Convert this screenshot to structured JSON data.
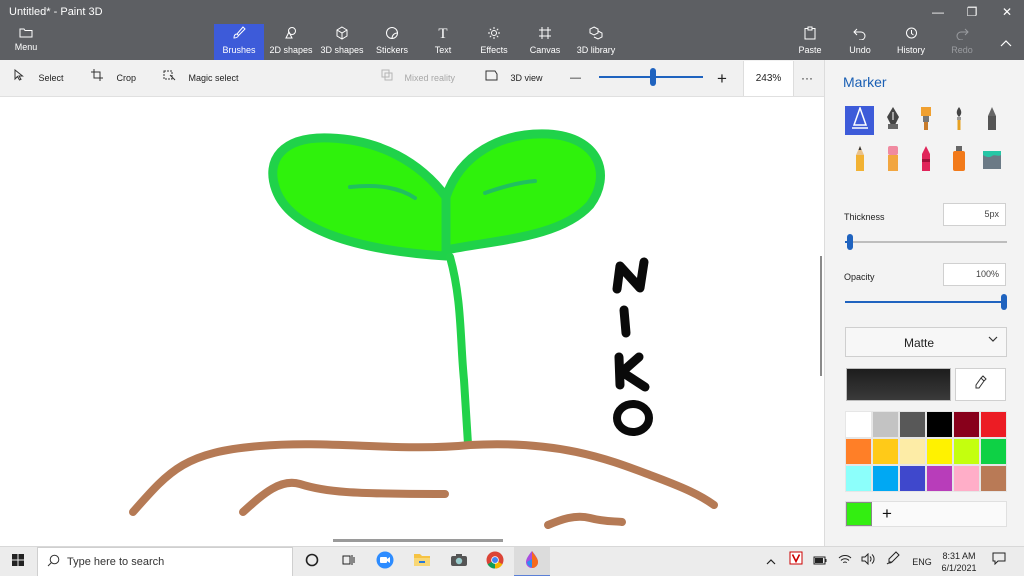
{
  "window": {
    "title": "Untitled* - Paint 3D",
    "minimize": "—",
    "maximize": "❐",
    "close": "✕"
  },
  "ribbon": {
    "menu_label": "Menu",
    "tools": [
      {
        "label": "Brushes",
        "icon": "brush-icon",
        "active": true
      },
      {
        "label": "2D shapes",
        "icon": "shapes-2d-icon"
      },
      {
        "label": "3D shapes",
        "icon": "cube-icon"
      },
      {
        "label": "Stickers",
        "icon": "sticker-icon"
      },
      {
        "label": "Text",
        "icon": "text-icon",
        "glyph": "T"
      },
      {
        "label": "Effects",
        "icon": "sun-icon"
      },
      {
        "label": "Canvas",
        "icon": "canvas-icon"
      },
      {
        "label": "3D library",
        "icon": "library-icon"
      }
    ],
    "right_tools": [
      {
        "label": "Paste",
        "icon": "paste-icon"
      },
      {
        "label": "Undo",
        "icon": "undo-icon"
      },
      {
        "label": "History",
        "icon": "history-icon"
      },
      {
        "label": "Redo",
        "icon": "redo-icon",
        "disabled": true
      }
    ]
  },
  "toolbar": {
    "select": "Select",
    "crop": "Crop",
    "magic_select": "Magic select",
    "mixed_reality": "Mixed reality",
    "view_3d": "3D view",
    "zoom_out": "—",
    "zoom_in": "+",
    "zoom_value": "243%",
    "zoom_fraction": 0.52,
    "more": "···"
  },
  "canvas": {
    "drawing_text": "NIKO",
    "colors": {
      "leaf_fill": "#2ff20c",
      "leaf_outline": "#20d24a",
      "stem": "#22d24a",
      "soil": "#b57a55",
      "ink": "#0a0a0a"
    }
  },
  "panel": {
    "title": "Marker",
    "brushes": [
      {
        "name": "marker-brush-icon",
        "selected": true
      },
      {
        "name": "calligraphy-pen-icon"
      },
      {
        "name": "oil-brush-icon"
      },
      {
        "name": "watercolor-icon"
      },
      {
        "name": "pixel-pen-icon"
      },
      {
        "name": "pencil-icon"
      },
      {
        "name": "eraser-icon"
      },
      {
        "name": "crayon-icon"
      },
      {
        "name": "spray-can-icon"
      },
      {
        "name": "fill-bucket-icon"
      }
    ],
    "thickness_label": "Thickness",
    "thickness_value": "5px",
    "thickness_fraction": 0.03,
    "opacity_label": "Opacity",
    "opacity_value": "100%",
    "opacity_fraction": 1.0,
    "finish": "Matte",
    "current_color": "#262626",
    "palette": [
      "#ffffff",
      "#c3c3c3",
      "#585858",
      "#000000",
      "#88001b",
      "#ec1c24",
      "#ff7f27",
      "#ffca18",
      "#fdeca6",
      "#fff200",
      "#c4ff0e",
      "#0ed145",
      "#8cfffb",
      "#00a8f3",
      "#3f48cc",
      "#b83dba",
      "#ffaec8",
      "#b97a56"
    ],
    "custom_color": "#33ee11",
    "add_color": "+"
  },
  "taskbar": {
    "search_placeholder": "Type here to search",
    "apps": [
      "cortana-icon",
      "task-view-icon",
      "zoom-app-icon",
      "file-explorer-icon",
      "camera-app-icon",
      "chrome-icon",
      "paint3d-icon"
    ],
    "tray": {
      "language": "ENG",
      "time": "8:31 AM",
      "date": "6/1/2021"
    }
  }
}
